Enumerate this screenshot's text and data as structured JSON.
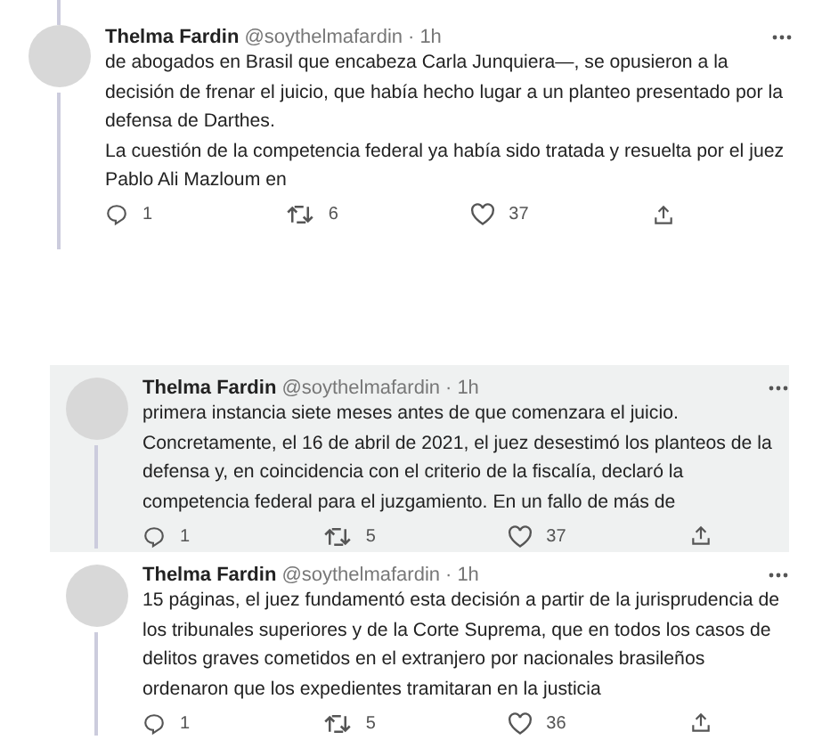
{
  "tweets": [
    {
      "kind": "main",
      "highlighted": false,
      "name": "Thelma Fardin",
      "handle": "@soythelmafardin",
      "separator": "·",
      "time": "1h",
      "paragraphs": [
        "de abogados en Brasil que encabeza Carla Junquiera—, se opusieron a la decisión de frenar el juicio, que había hecho lugar a un planteo presentado por la defensa de Darthes.",
        "La cuestión de la competencia federal ya había sido tratada y resuelta por el juez Pablo Ali Mazloum en"
      ],
      "replies": "1",
      "retweets": "6",
      "likes": "37"
    },
    {
      "kind": "nested",
      "highlighted": true,
      "name": "Thelma Fardin",
      "handle": "@soythelmafardin",
      "separator": "·",
      "time": "1h",
      "paragraphs": [
        "primera instancia siete meses antes de que comenzara el juicio. Concretamente, el 16 de abril de 2021, el juez desestimó los planteos de la defensa y, en coincidencia con el criterio de la fiscalía, declaró la competencia federal para el juzgamiento. En un fallo de más de"
      ],
      "replies": "1",
      "retweets": "5",
      "likes": "37"
    },
    {
      "kind": "nested",
      "highlighted": false,
      "name": "Thelma Fardin",
      "handle": "@soythelmafardin",
      "separator": "·",
      "time": "1h",
      "paragraphs": [
        "15 páginas, el juez fundamentó esta decisión a partir de la jurisprudencia de los tribunales superiores y de la Corte Suprema, que en todos los casos de delitos graves cometidos en el extranjero por nacionales brasileños ordenaron que los expedientes tramitaran en la justicia"
      ],
      "replies": "1",
      "retweets": "5",
      "likes": "36"
    }
  ]
}
